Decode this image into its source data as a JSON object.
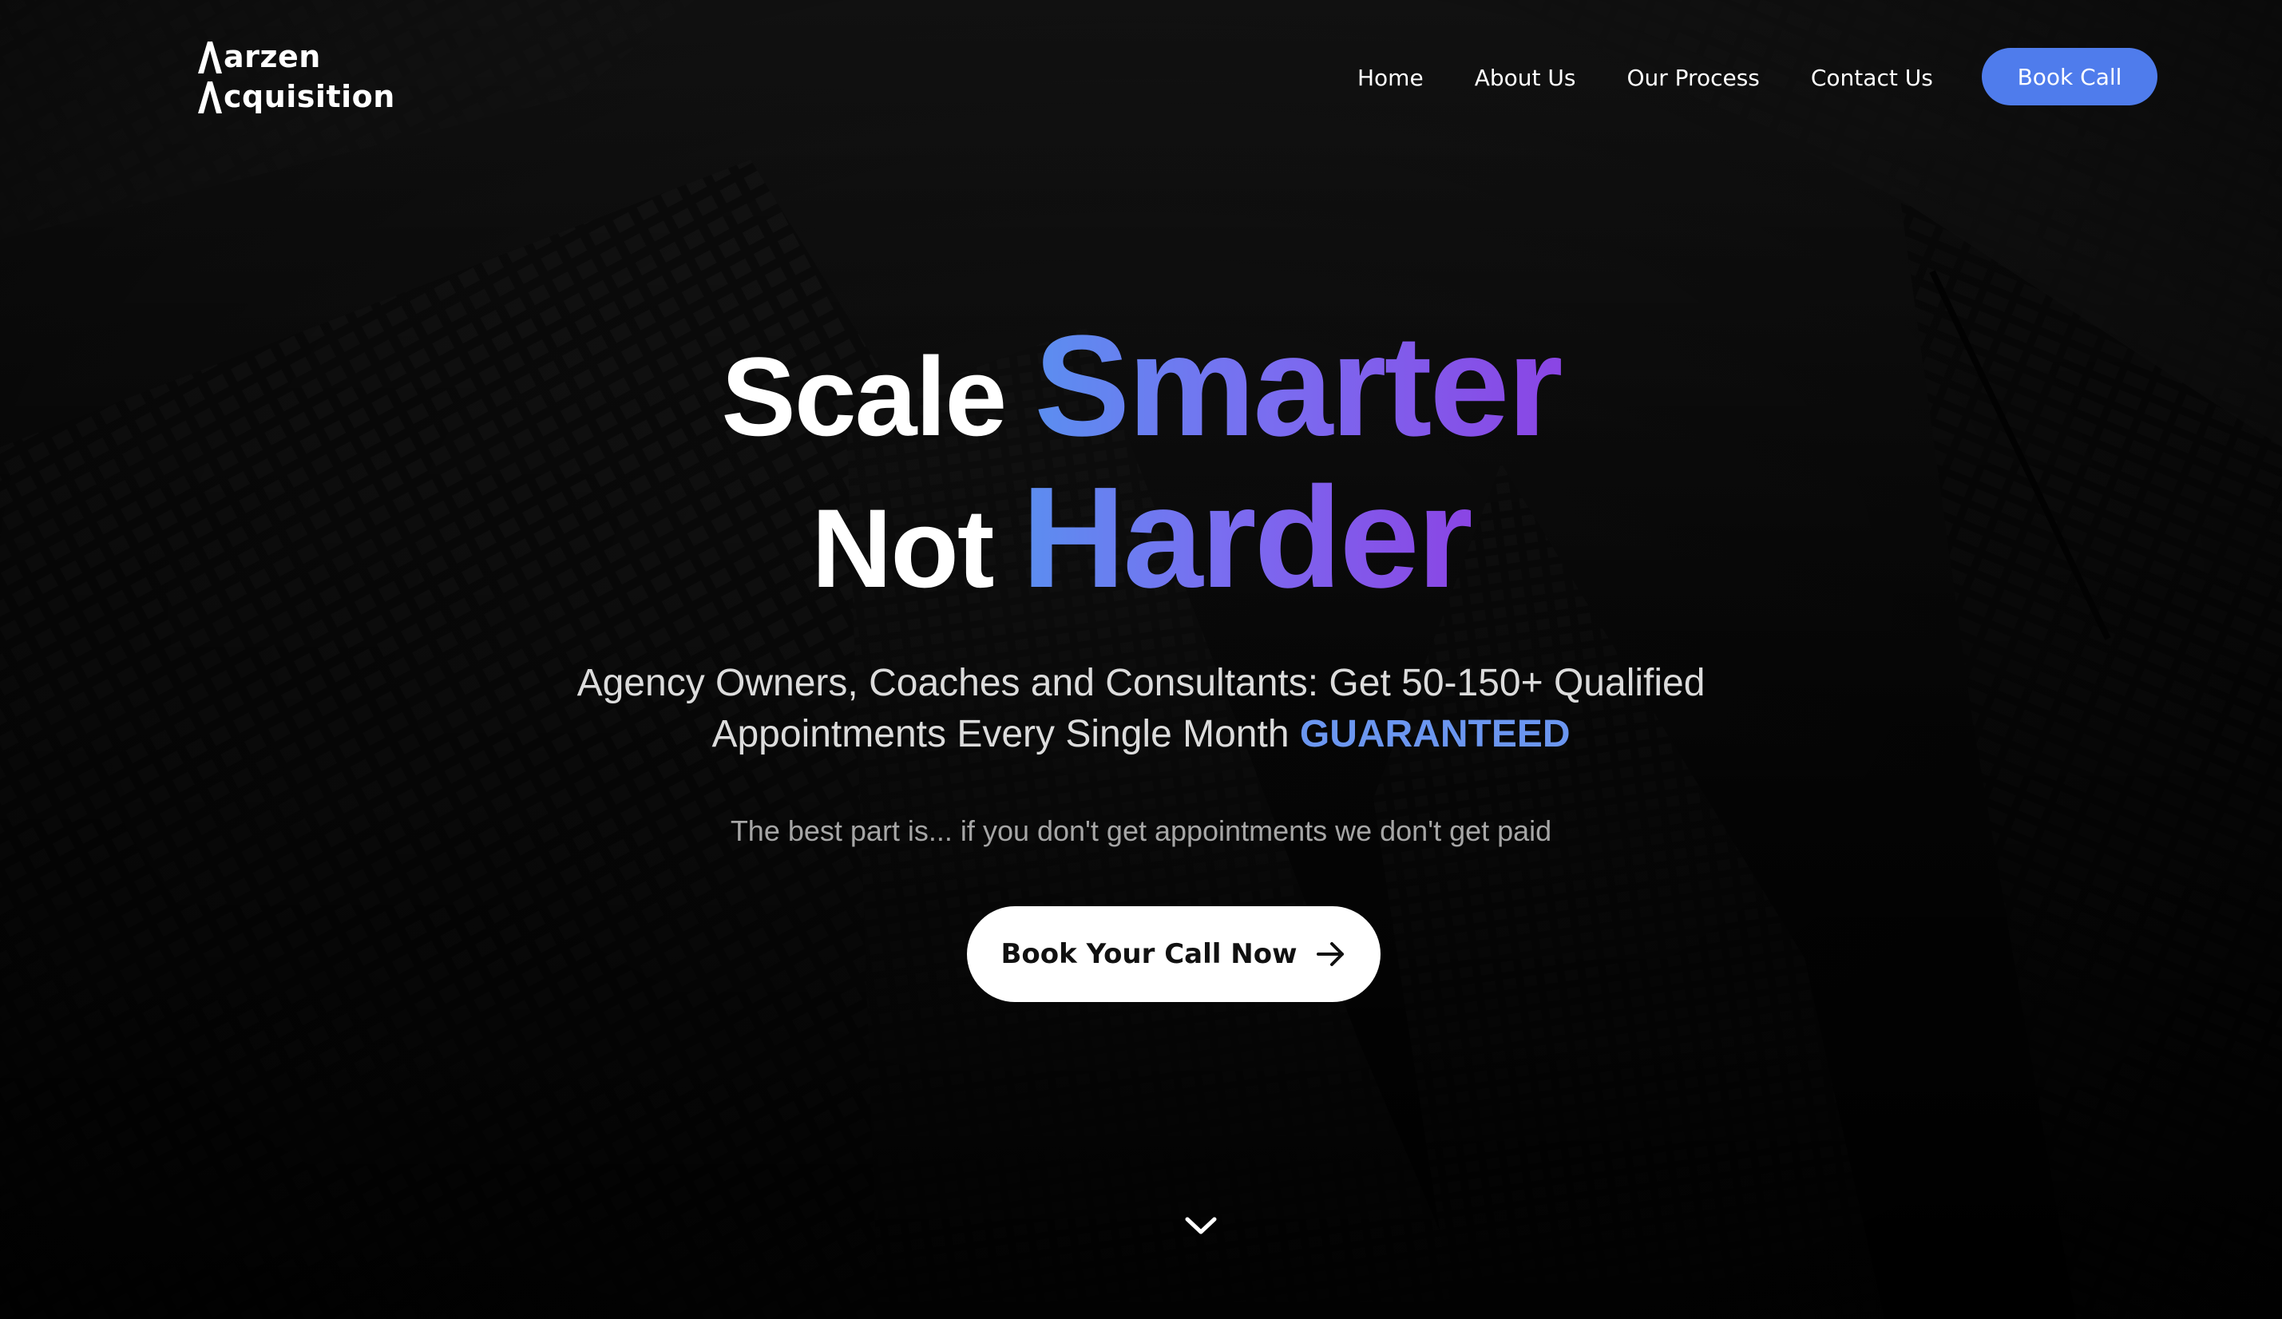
{
  "brand": {
    "line1": "arzen",
    "line2": "cquisition",
    "logo_mark": "lambda-a-icon"
  },
  "nav": {
    "items": [
      {
        "label": "Home"
      },
      {
        "label": "About Us"
      },
      {
        "label": "Our Process"
      },
      {
        "label": "Contact Us"
      }
    ],
    "cta_label": "Book Call"
  },
  "hero": {
    "line1_plain": "Scale",
    "line1_accent": "Smarter",
    "line2_plain": "Not",
    "line2_accent": "Harder",
    "subtitle_line1": "Agency Owners, Coaches and Consultants: Get 50-150+ Qualified",
    "subtitle_line2": "Appointments Every Single Month",
    "subtitle_highlight": "GUARANTEED",
    "note": "The best part is... if you don't get appointments we don't get paid",
    "cta_label": "Book Your Call Now",
    "cta_icon": "arrow-right-icon",
    "scroll_icon": "chevron-down-icon"
  },
  "colors": {
    "accent_button": "#4f7cec",
    "gradient_start": "#5b8ef0",
    "gradient_end": "#8a45e4",
    "highlight": "#6b96f0"
  }
}
